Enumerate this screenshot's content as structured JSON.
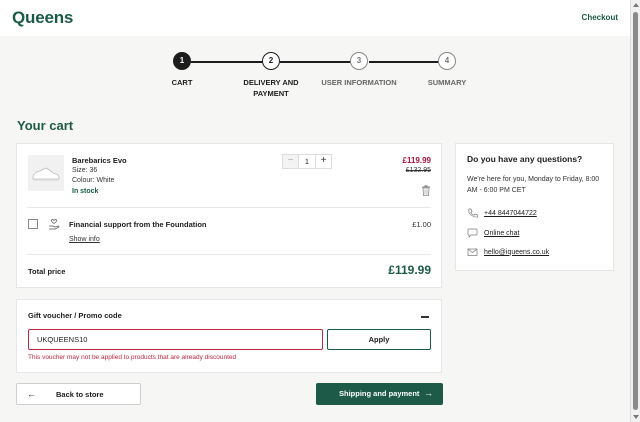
{
  "header": {
    "logo": "Queens",
    "checkout_label": "Checkout"
  },
  "stepper": {
    "steps": [
      {
        "number": "1",
        "label": "CART",
        "state": "active"
      },
      {
        "number": "2",
        "label": "DELIVERY AND PAYMENT",
        "state": "done"
      },
      {
        "number": "3",
        "label": "USER INFORMATION",
        "state": "todo"
      },
      {
        "number": "4",
        "label": "SUMMARY",
        "state": "todo"
      }
    ]
  },
  "cart": {
    "title": "Your cart",
    "product": {
      "name": "Barebarics Evo",
      "size": "Size: 36",
      "colour": "Colour: White",
      "stock": "In stock",
      "quantity": "1",
      "price_now": "£119.99",
      "price_old": "£132.95"
    },
    "support": {
      "label": "Financial support from the Foundation",
      "price": "£1.00",
      "show_info": "Show info"
    },
    "total_label": "Total price",
    "total_value": "£119.99"
  },
  "voucher": {
    "title": "Gift voucher / Promo code",
    "code": "UKQUEENS10",
    "apply_label": "Apply",
    "error": "This voucher may not be applied to products that are already discounted"
  },
  "actions": {
    "back_label": "Back to store",
    "ship_label": "Shipping and payment"
  },
  "help": {
    "title": "Do you have any questions?",
    "text": "We're here for you, Monday to Friday, 8:00 AM - 6:00 PM CET",
    "phone": "+44 8447044722",
    "chat": "Online chat",
    "email": "hello@iqueens.co.uk"
  },
  "colors": {
    "brand": "#1d5a47",
    "sale": "#b0153a",
    "error": "#c0263f"
  }
}
